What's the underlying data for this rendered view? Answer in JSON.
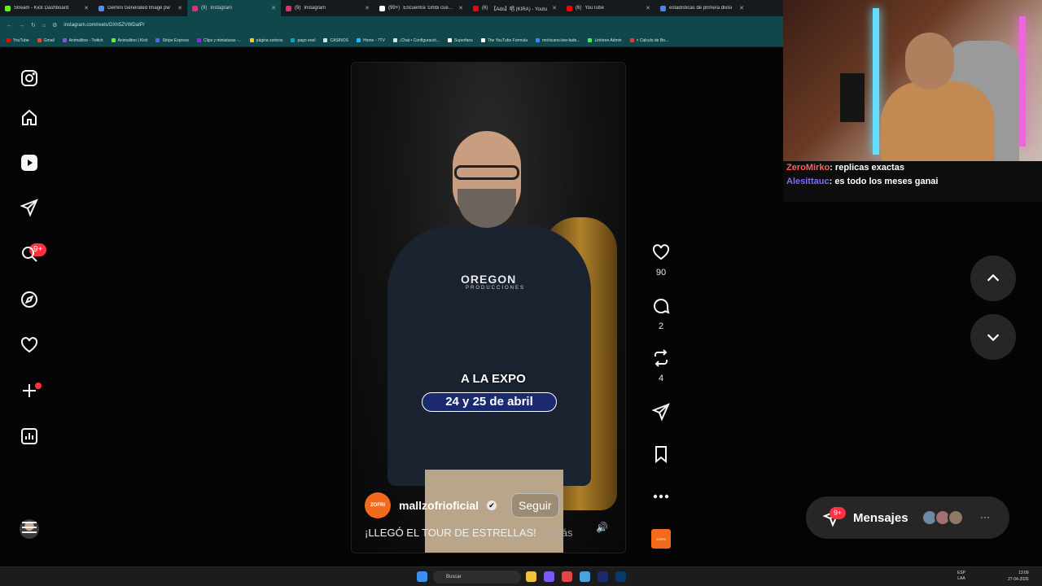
{
  "browser": {
    "tabs": [
      {
        "title": "Stream - Kick Dashboard",
        "color": "#53fc18"
      },
      {
        "title": "Gemini Generated Image pw",
        "color": "#4f8cf7"
      },
      {
        "title": "Instagram",
        "color": "#e1306c",
        "active": true,
        "prefix": "(9)"
      },
      {
        "title": "Instagram",
        "color": "#e1306c",
        "prefix": "(9)"
      },
      {
        "title": "Encuentra 'cimbi cuevas'",
        "color": "#ffffff",
        "prefix": "(99+)"
      },
      {
        "title": "【Ado】唱 (KIRA) - Youtu",
        "color": "#ff0000",
        "prefix": "(6)"
      },
      {
        "title": "YouTube",
        "color": "#ff0000",
        "prefix": "(6)"
      },
      {
        "title": "estadísticas de primera divisi",
        "color": "#4285f4"
      }
    ],
    "url": "instagram.com/reels/DXh5ZVWDaIP/",
    "bookmarks": [
      {
        "label": "YouTube",
        "color": "#ff0000"
      },
      {
        "label": "Gmail",
        "color": "#ea4335"
      },
      {
        "label": "Animalitoo - Twitch",
        "color": "#9146ff"
      },
      {
        "label": "Animalitoo | Kick",
        "color": "#53fc18"
      },
      {
        "label": "Stripe Express",
        "color": "#635bff"
      },
      {
        "label": "Clips y miniaturas -...",
        "color": "#8a2be2"
      },
      {
        "label": "página sorteos",
        "color": "#ffcc00"
      },
      {
        "label": "pago enel",
        "color": "#00a3e0"
      },
      {
        "label": "CASINOS",
        "color": "#dddddd"
      },
      {
        "label": "Home - 7TV",
        "color": "#29b6f6"
      },
      {
        "label": "¡Chat • Configuració...",
        "color": "#dddddd"
      },
      {
        "label": "Superfans",
        "color": "#ffffff"
      },
      {
        "label": "The YouTube Formula",
        "color": "#ffffff"
      },
      {
        "label": "mohicano-low-fade...",
        "color": "#4285f4"
      },
      {
        "label": "Linktree Admin",
        "color": "#43e660"
      },
      {
        "label": "× Calculo de Bo...",
        "color": "#e53935"
      }
    ]
  },
  "sidebar": {
    "notification_badge": "9+"
  },
  "reel": {
    "brand": "OREGON",
    "brand_sub": "PRODUCCIONES",
    "overlay_line1": "A LA EXPO",
    "overlay_line2": "24 y 25 de abril",
    "author": "mallzofrioficial",
    "author_logo_text": "ZOFRI",
    "verified": "✔",
    "follow_label": "Seguir",
    "caption": "¡LLEGÓ EL TOUR DE ESTRELLAS!",
    "more_label": "… más",
    "volume_icon": "🔊",
    "thumbnail_text": "ZOFRI"
  },
  "actions": {
    "likes": "90",
    "comments": "2",
    "reposts": "4"
  },
  "messages": {
    "label": "Mensajes",
    "badge": "9+",
    "more_icon": "···"
  },
  "stream_chat": [
    {
      "user": "ZeroMirko",
      "message": "replicas exactas"
    },
    {
      "user": "Alesittauc",
      "message": "es todo los meses ganai"
    }
  ],
  "taskbar": {
    "search_placeholder": "Buscar",
    "lang_top": "ESP",
    "lang_bottom": "LAA",
    "time": "13:09",
    "date": "27-04-2026"
  }
}
